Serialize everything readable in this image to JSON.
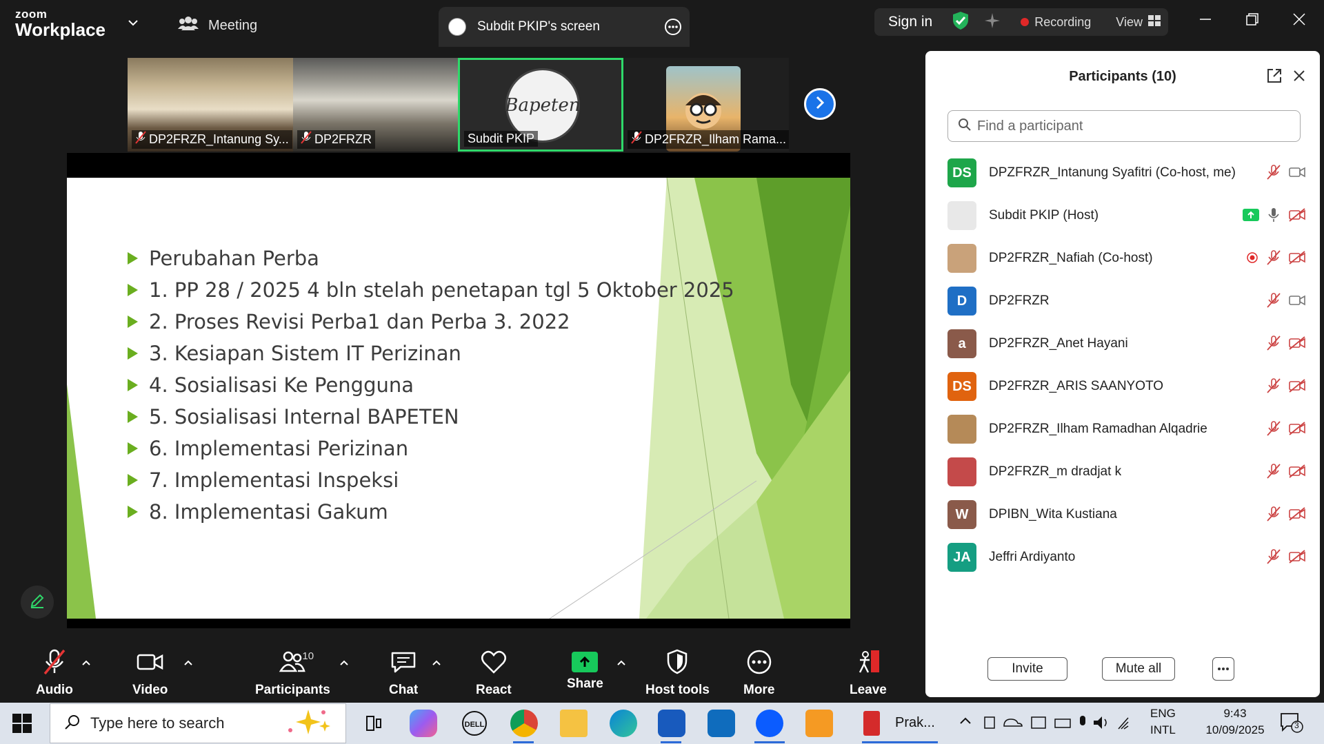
{
  "window": {
    "brand_top": "zoom",
    "brand_bottom": "Workplace",
    "meeting_tab": "Meeting",
    "screen_tab": "Subdit PKIP's screen",
    "sign_in": "Sign in",
    "recording": "Recording",
    "view": "View",
    "recording_color": "#e02828"
  },
  "thumbnails": [
    {
      "label": "DP2FRZR_Intanung Sy...",
      "muted": true
    },
    {
      "label": "DP2FRZR",
      "muted": true
    },
    {
      "label": "Subdit PKIP",
      "muted": false,
      "logo_text": "Bapeten"
    },
    {
      "label": "DP2FRZR_Ilham Rama...",
      "muted": true
    }
  ],
  "slide": {
    "items": [
      "Perubahan Perba",
      "1. PP 28 / 2025 4 bln stelah penetapan  tgl 5 Oktober 2025",
      "2. Proses Revisi Perba1 dan Perba 3. 2022",
      "3. Kesiapan Sistem IT Perizinan",
      "4. Sosialisasi Ke Pengguna",
      "5. Sosialisasi Internal BAPETEN",
      "6. Implementasi Perizinan",
      "7. Implementasi Inspeksi",
      "8. Implementasi Gakum"
    ],
    "accent_color": "#6aae1f"
  },
  "toolbar": {
    "audio": "Audio",
    "video": "Video",
    "participants": "Participants",
    "participants_count": "10",
    "chat": "Chat",
    "react": "React",
    "share": "Share",
    "host_tools": "Host tools",
    "more": "More",
    "leave": "Leave",
    "share_color": "#17c95b"
  },
  "panel": {
    "title": "Participants (10)",
    "search_placeholder": "Find a participant",
    "invite": "Invite",
    "mute_all": "Mute all",
    "participants": [
      {
        "initials": "DS",
        "color": "#1ea64a",
        "name": "DPZFRZR_Intanung Syafitri (Co-host, me)",
        "mic": "muted",
        "cam": "on"
      },
      {
        "initials": "",
        "color": "#e8e8e8",
        "name": "Subdit PKIP (Host)",
        "mic": "on",
        "cam": "off",
        "sharing": true
      },
      {
        "initials": "",
        "color": "#c9a27a",
        "name": "DP2FRZR_Nafiah (Co-host)",
        "mic": "muted",
        "cam": "off",
        "recording": true
      },
      {
        "initials": "D",
        "color": "#1f6fc5",
        "name": "DP2FRZR",
        "mic": "muted",
        "cam": "on"
      },
      {
        "initials": "a",
        "color": "#8a5a4a",
        "name": "DP2FRZR_Anet Hayani",
        "mic": "muted",
        "cam": "off"
      },
      {
        "initials": "DS",
        "color": "#e0630f",
        "name": "DP2FRZR_ARIS SAANYOTO",
        "mic": "muted",
        "cam": "off"
      },
      {
        "initials": "",
        "color": "#b58a58",
        "name": "DP2FRZR_Ilham Ramadhan Alqadrie",
        "mic": "muted",
        "cam": "off"
      },
      {
        "initials": "",
        "color": "#c44a4a",
        "name": "DP2FRZR_m dradjat k",
        "mic": "muted",
        "cam": "off"
      },
      {
        "initials": "W",
        "color": "#8a5a4a",
        "name": "DPIBN_Wita Kustiana",
        "mic": "muted",
        "cam": "off"
      },
      {
        "initials": "JA",
        "color": "#159e82",
        "name": "Jeffri Ardiyanto",
        "mic": "muted",
        "cam": "off"
      }
    ]
  },
  "taskbar": {
    "search_placeholder": "Type here to search",
    "prak_label": "Prak...",
    "lang_top": "ENG",
    "lang_bottom": "INTL",
    "time": "9:43",
    "date": "10/09/2025",
    "notification_count": "3"
  }
}
